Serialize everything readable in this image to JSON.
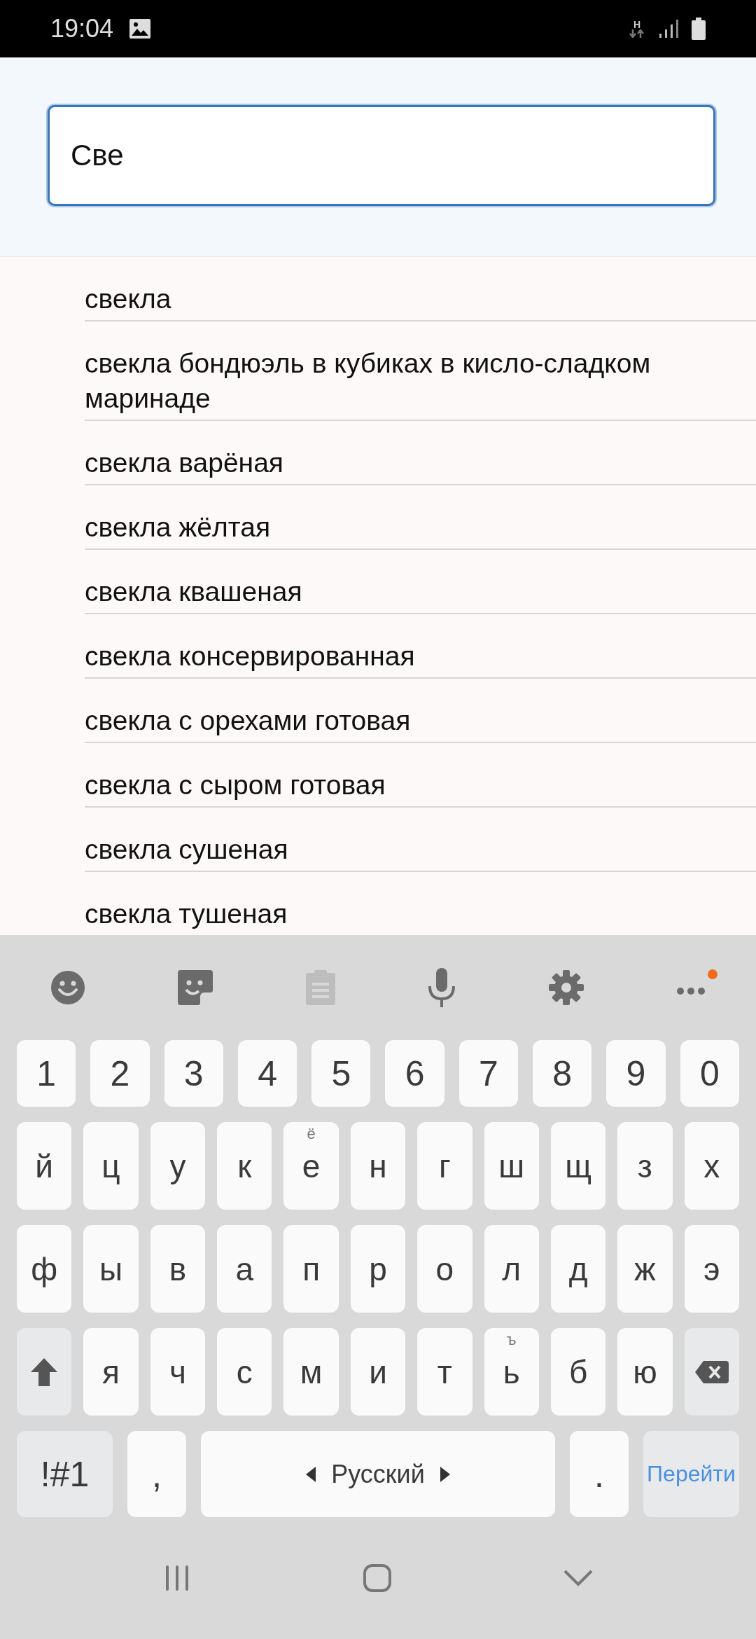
{
  "status_bar": {
    "time": "19:04",
    "network": "H"
  },
  "search": {
    "value": "Све"
  },
  "suggestions": [
    "свекла",
    "свекла бондюэль в кубиках в кисло-сладком маринаде",
    "свекла варёная",
    "свекла жёлтая",
    "свекла квашеная",
    "свекла консервированная",
    "свекла с орехами готовая",
    "свекла с сыром готовая",
    "свекла сушеная",
    "свекла тушеная"
  ],
  "keyboard": {
    "toolbar": [
      {
        "kind": "emoji",
        "disabled": false
      },
      {
        "kind": "sticker",
        "disabled": false
      },
      {
        "kind": "clipboard",
        "disabled": true
      },
      {
        "kind": "mic",
        "disabled": false
      },
      {
        "kind": "settings",
        "disabled": false
      },
      {
        "kind": "more",
        "disabled": false,
        "notification": true
      }
    ],
    "number_row": [
      "1",
      "2",
      "3",
      "4",
      "5",
      "6",
      "7",
      "8",
      "9",
      "0"
    ],
    "rows": [
      [
        {
          "kind": "letter",
          "label": "й"
        },
        {
          "kind": "letter",
          "label": "ц"
        },
        {
          "kind": "letter",
          "label": "у"
        },
        {
          "kind": "letter",
          "label": "к"
        },
        {
          "kind": "letter",
          "label": "е",
          "hint": "ё"
        },
        {
          "kind": "letter",
          "label": "н"
        },
        {
          "kind": "letter",
          "label": "г"
        },
        {
          "kind": "letter",
          "label": "ш"
        },
        {
          "kind": "letter",
          "label": "щ"
        },
        {
          "kind": "letter",
          "label": "з"
        },
        {
          "kind": "letter",
          "label": "х"
        }
      ],
      [
        {
          "kind": "letter",
          "label": "ф"
        },
        {
          "kind": "letter",
          "label": "ы"
        },
        {
          "kind": "letter",
          "label": "в"
        },
        {
          "kind": "letter",
          "label": "а"
        },
        {
          "kind": "letter",
          "label": "п"
        },
        {
          "kind": "letter",
          "label": "р"
        },
        {
          "kind": "letter",
          "label": "о"
        },
        {
          "kind": "letter",
          "label": "л"
        },
        {
          "kind": "letter",
          "label": "д"
        },
        {
          "kind": "letter",
          "label": "ж"
        },
        {
          "kind": "letter",
          "label": "э"
        }
      ],
      [
        {
          "kind": "shift"
        },
        {
          "kind": "letter",
          "label": "я"
        },
        {
          "kind": "letter",
          "label": "ч"
        },
        {
          "kind": "letter",
          "label": "с"
        },
        {
          "kind": "letter",
          "label": "м"
        },
        {
          "kind": "letter",
          "label": "и"
        },
        {
          "kind": "letter",
          "label": "т"
        },
        {
          "kind": "letter",
          "label": "ь",
          "hint": "ъ"
        },
        {
          "kind": "letter",
          "label": "б"
        },
        {
          "kind": "letter",
          "label": "ю"
        },
        {
          "kind": "backspace"
        }
      ]
    ],
    "bottom_row": [
      {
        "kind": "symbols",
        "label": "!#1"
      },
      {
        "kind": "char",
        "label": ","
      },
      {
        "kind": "space",
        "label": "Русский"
      },
      {
        "kind": "char",
        "label": "."
      },
      {
        "kind": "action",
        "label": "Перейти"
      }
    ]
  },
  "nav_bar": [
    {
      "kind": "recents"
    },
    {
      "kind": "home"
    },
    {
      "kind": "back"
    }
  ]
}
